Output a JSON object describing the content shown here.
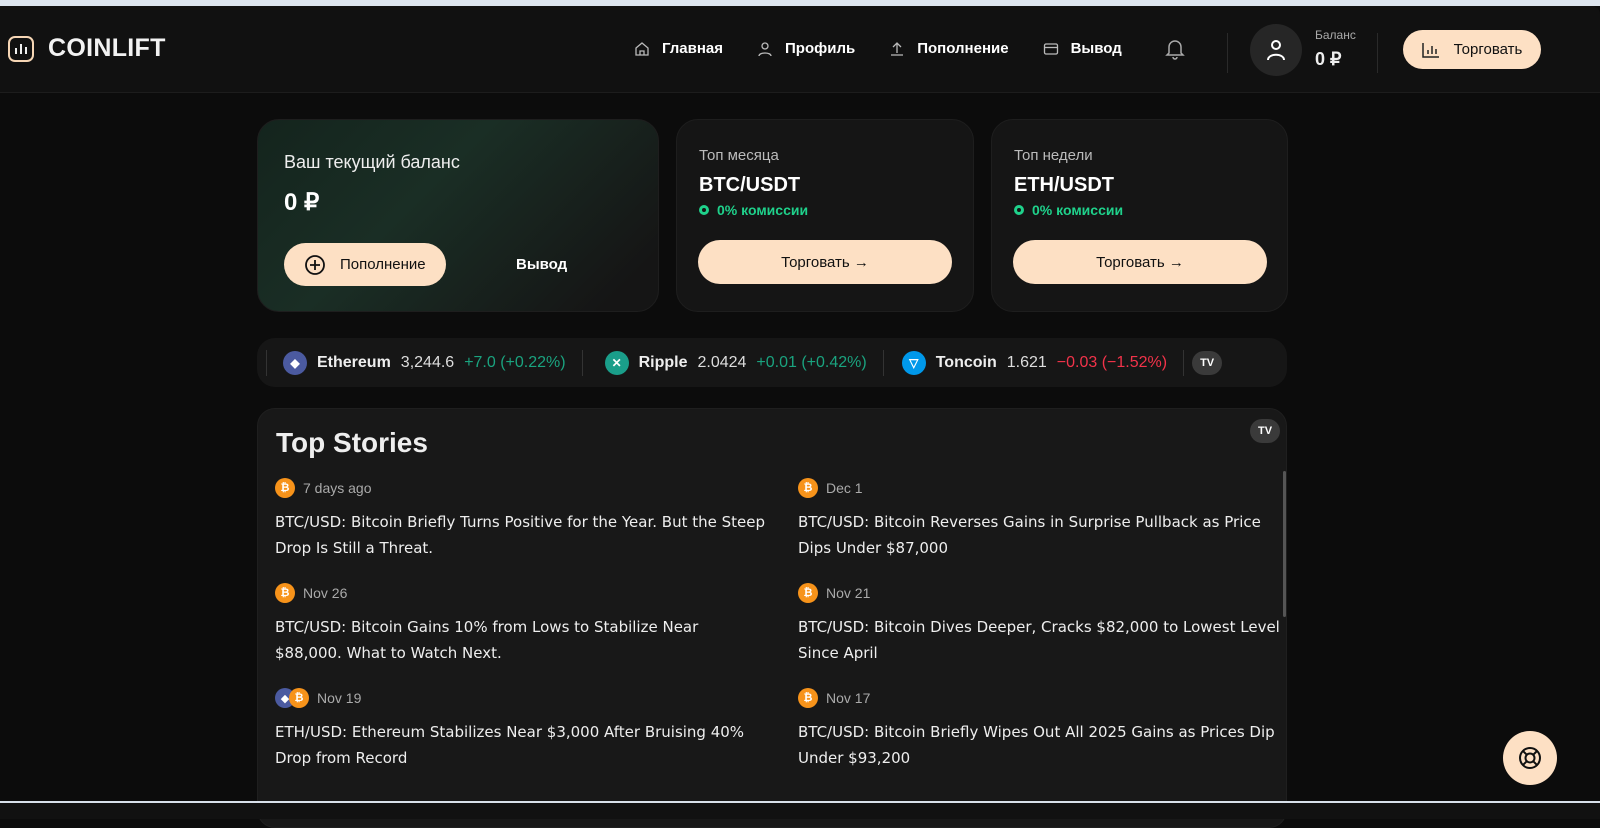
{
  "header": {
    "logo": "COINLIFT",
    "nav": [
      {
        "label": "Главная",
        "icon": "home-icon"
      },
      {
        "label": "Профиль",
        "icon": "user-icon"
      },
      {
        "label": "Пополнение",
        "icon": "upload-icon"
      },
      {
        "label": "Вывод",
        "icon": "card-icon"
      }
    ],
    "balance_label": "Баланс",
    "balance_value": "0 ₽",
    "trade_label": "Торговать"
  },
  "balance_card": {
    "title": "Ваш текущий баланс",
    "amount": "0 ₽",
    "deposit_label": "Пополнение",
    "withdraw_label": "Вывод"
  },
  "top_cards": [
    {
      "label": "Топ месяца",
      "pair": "BTC/USDT",
      "fee": "0% комиссии",
      "button": "Торговать →"
    },
    {
      "label": "Топ недели",
      "pair": "ETH/USDT",
      "fee": "0% комиссии",
      "button": "Торговать →"
    }
  ],
  "ticker": [
    {
      "name": "Ethereum",
      "price": "3,244.6",
      "change": "+7.0 (+0.22%)",
      "dir": "up"
    },
    {
      "name": "Ripple",
      "price": "2.0424",
      "change": "+0.01 (+0.42%)",
      "dir": "up"
    },
    {
      "name": "Toncoin",
      "price": "1.621",
      "change": "−0.03 (−1.52%)",
      "dir": "down"
    }
  ],
  "stories": {
    "title": "Top Stories",
    "items": [
      {
        "date": "7 days ago",
        "title": "BTC/USD: Bitcoin Briefly Turns Positive for the Year. But the Steep Drop Is Still a Threat.",
        "coins": [
          "btc"
        ]
      },
      {
        "date": "Dec 1",
        "title": "BTC/USD: Bitcoin Reverses Gains in Surprise Pullback as Price Dips Under $87,000",
        "coins": [
          "btc"
        ]
      },
      {
        "date": "Nov 26",
        "title": "BTC/USD: Bitcoin Gains 10% from Lows to Stabilize Near $88,000. What to Watch Next.",
        "coins": [
          "btc"
        ]
      },
      {
        "date": "Nov 21",
        "title": "BTC/USD: Bitcoin Dives Deeper, Cracks $82,000 to Lowest Level Since April",
        "coins": [
          "btc"
        ]
      },
      {
        "date": "Nov 19",
        "title": "ETH/USD: Ethereum Stabilizes Near $3,000 After Bruising 40% Drop from Record",
        "coins": [
          "eth",
          "btc"
        ]
      },
      {
        "date": "Nov 17",
        "title": "BTC/USD: Bitcoin Briefly Wipes Out All 2025 Gains as Prices Dip Under $93,200",
        "coins": [
          "btc"
        ]
      }
    ]
  },
  "colors": {
    "accent": "#fde0c4",
    "green": "#1fd18b",
    "up": "#1aa37f",
    "down": "#f2334a"
  }
}
